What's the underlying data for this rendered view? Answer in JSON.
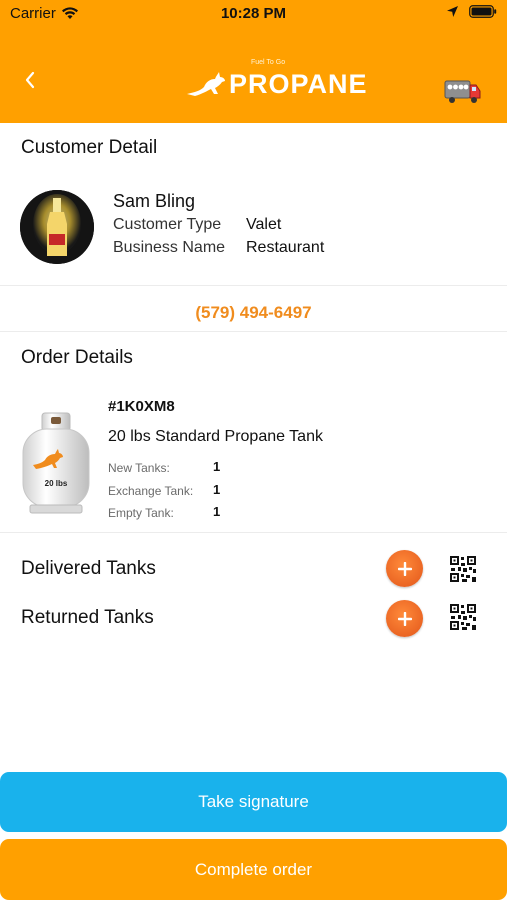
{
  "status_bar": {
    "carrier": "Carrier",
    "time": "10:28 PM"
  },
  "header": {
    "logo_text": "PROPANE",
    "logo_tagline": "Fuel To Go",
    "back_icon": "chevron-left-icon",
    "truck_icon": "delivery-truck-icon"
  },
  "customer": {
    "section_title": "Customer Detail",
    "name": "Sam Bling",
    "type_label": "Customer Type",
    "type_value": "Valet",
    "business_label": "Business Name",
    "business_value": "Restaurant",
    "phone": "(579) 494-6497"
  },
  "order": {
    "section_title": "Order Details",
    "order_id": "#1K0XM8",
    "product_name": "20 lbs Standard Propane Tank",
    "tank_label": "20 lbs",
    "new_label": "New Tanks:",
    "new_value": "1",
    "exchange_label": "Exchange Tank:",
    "exchange_value": "1",
    "empty_label": "Empty Tank:",
    "empty_value": "1"
  },
  "tanks": {
    "delivered_label": "Delivered Tanks",
    "returned_label": "Returned Tanks"
  },
  "actions": {
    "signature_label": "Take signature",
    "complete_label": "Complete order"
  },
  "colors": {
    "brand_orange": "#FFA000",
    "phone_orange": "#F08C1E",
    "signature_blue": "#19B2EC"
  }
}
